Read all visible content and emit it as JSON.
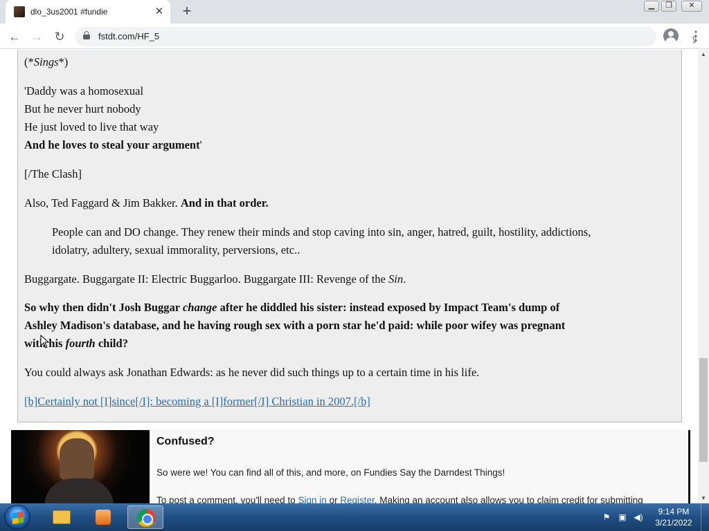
{
  "browser": {
    "tab_title": "dlo_3us2001 #fundie",
    "tab_close": "✕",
    "new_tab": "+",
    "url": "fstdt.com/HF_5",
    "window_min": "▁",
    "window_max": "❐",
    "window_close": "✕"
  },
  "post": {
    "lines": [
      {
        "open": "(*",
        "em": "Sings",
        "close": "*)"
      },
      "'Daddy was a homosexual",
      "But he never hurt nobody",
      "He just loved to live that way",
      "And he loves to steal your argument",
      "'",
      "[/The Clash]",
      "Also, Ted Faggard & Jim Bakker. ",
      "And in that order.",
      "People can and DO change. They renew their minds and stop caving into sin, anger, hatred, guilt, hostility, addictions,",
      "idolatry, adultery, sexual immorality, perversions, etc..",
      "Buggargate. Buggargate II: Electric Buggarloo. Buggargate III: Revenge of the ",
      "Sin",
      ".",
      "So why then didn't Josh Buggar ",
      "change",
      " after he diddled his sister: instead exposed by Impact Team's dump of",
      "Ashley Madison's database, and he having rough sex with a porn star he'd paid: while poor wifey was pregnant",
      "with his ",
      "fourth",
      " child?",
      "You could always ask Jonathan Edwards: as he never did such things up to a certain time in his life.",
      "[b]Certainly not [I]since[/I]: becoming a [I]former[/I] Christian in 2007.[/b]"
    ]
  },
  "ad": {
    "title": "Confused?",
    "text1": "So were we! You can find all of this, and more, on Fundies Say the Darndest Things!",
    "text2_prefix": "To post a comment, you'll need to ",
    "sign_in": "Sign in",
    "or": " or ",
    "register": "Register",
    "text2_suffix": ". Making an account also allows you to claim credit for submitting"
  },
  "taskbar": {
    "time": "9:14 PM",
    "date": "3/21/2022"
  }
}
